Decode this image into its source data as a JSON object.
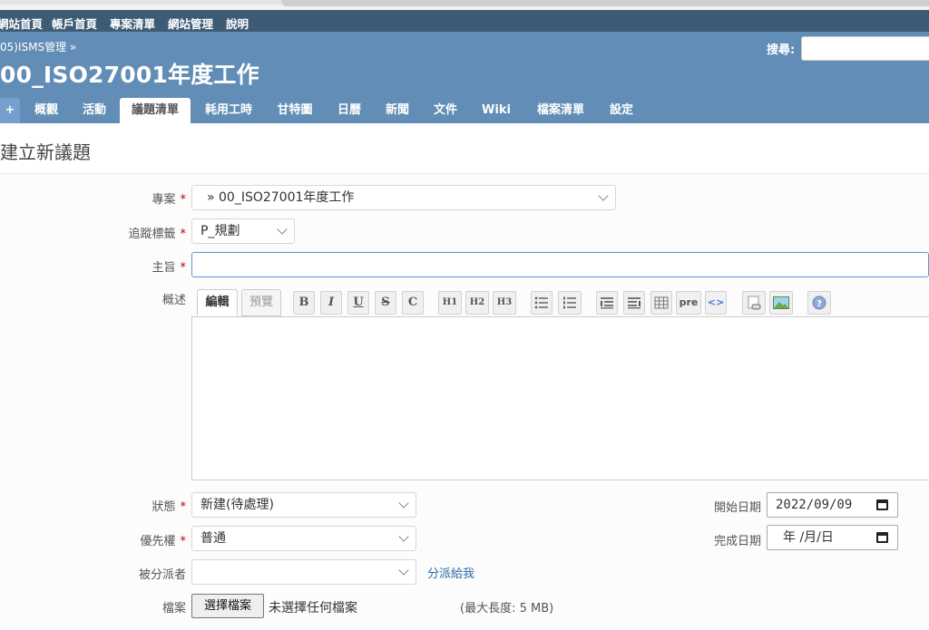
{
  "top_menu": [
    "網站首頁",
    "帳戶首頁",
    "專案清單",
    "網站管理",
    "說明"
  ],
  "header": {
    "breadcrumb": "05)ISMS管理 »",
    "project_title": "00_ISO27001年度工作",
    "search_label": "搜尋:",
    "search_placeholder": ""
  },
  "tabs": {
    "plus": "+",
    "items": [
      "概觀",
      "活動",
      "議題清單",
      "耗用工時",
      "甘特圖",
      "日曆",
      "新聞",
      "文件",
      "Wiki",
      "檔案清單",
      "設定"
    ],
    "selected": "議題清單"
  },
  "page_heading": "建立新議題",
  "form": {
    "required_mark": "*",
    "project_label": "專案",
    "project_value": "» 00_ISO27001年度工作",
    "tracker_label": "追蹤標籤",
    "tracker_value": "P_規劃",
    "subject_label": "主旨",
    "subject_value": "",
    "description_label": "概述",
    "editor_tabs": [
      "編輯",
      "預覽"
    ],
    "toolbar": {
      "bold": "B",
      "italic": "I",
      "underline": "U",
      "strike": "S",
      "code": "C",
      "h1": "H1",
      "h2": "H2",
      "h3": "H3",
      "pre": "pre",
      "inline_code": "<>",
      "help": "?"
    },
    "status_label": "狀態",
    "status_value": "新建(待處理)",
    "priority_label": "優先權",
    "priority_value": "普通",
    "assignee_label": "被分派者",
    "assignee_value": "",
    "assign_to_me": "分派給我",
    "start_date_label": "開始日期",
    "start_date_value": "2022/09/09",
    "due_date_label": "完成日期",
    "due_date_value": "年 /月/日",
    "files_label": "檔案",
    "choose_file_button": "選擇檔案",
    "no_file_text": "未選擇任何檔案",
    "max_size_text": "(最大長度: 5 MB)"
  },
  "colors": {
    "top_menu_bg": "#3e5b76",
    "header_bg": "#628db6",
    "link": "#2a6ba8",
    "required": "#bb0000"
  }
}
